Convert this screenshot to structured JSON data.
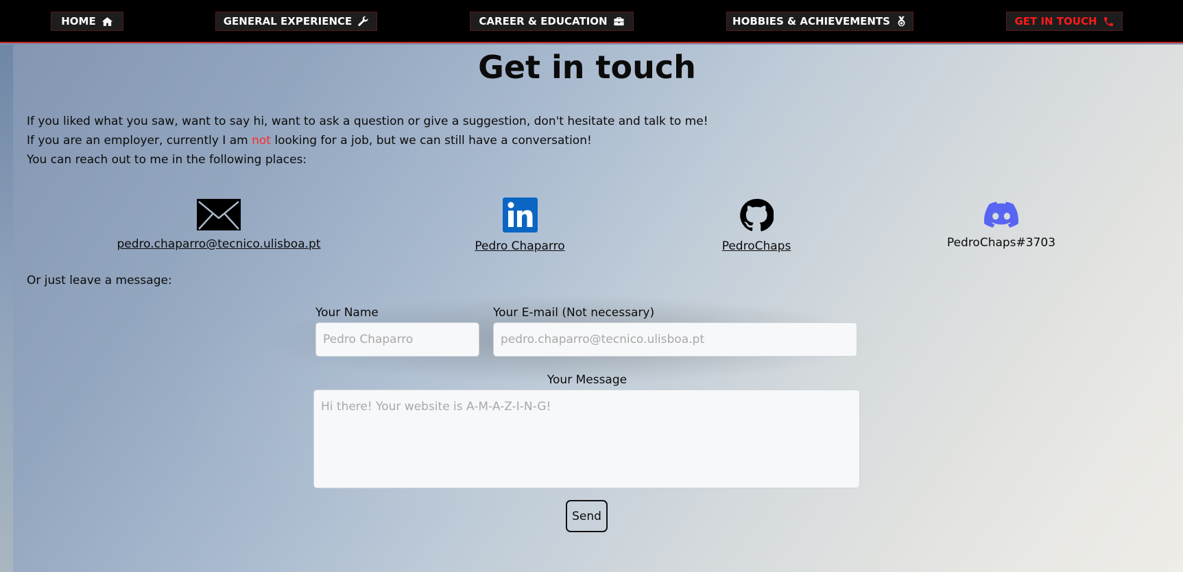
{
  "nav": {
    "items": [
      {
        "label": "HOME",
        "icon": "home-icon"
      },
      {
        "label": "GENERAL EXPERIENCE",
        "icon": "wrench-icon"
      },
      {
        "label": "CAREER & EDUCATION",
        "icon": "briefcase-icon"
      },
      {
        "label": "HOBBIES & ACHIEVEMENTS",
        "icon": "medal-icon"
      },
      {
        "label": "GET IN TOUCH",
        "icon": "phone-icon"
      }
    ],
    "active": "GET IN TOUCH",
    "active_color": "#ff1a1a",
    "accent_border": "#c62828"
  },
  "page": {
    "title": "Get in touch",
    "intro_line1": "If you liked what you saw, want to say hi, want to ask a question or give a suggestion, don't hesitate and talk to me!",
    "intro_line2_before": "If you are an employer, currently I am ",
    "intro_line2_emph": "not",
    "intro_line2_after": " looking for a job, but we can still have a conversation!",
    "intro_line3": "You can reach out to me in the following places:",
    "leave_message": "Or just leave a message:"
  },
  "contacts": {
    "email": {
      "label": "pedro.chaparro@tecnico.ulisboa.pt",
      "icon": "envelope-icon"
    },
    "linkedin": {
      "label": "Pedro Chaparro",
      "icon": "linkedin-icon",
      "color": "#0a66c2"
    },
    "github": {
      "label": "PedroChaps",
      "icon": "github-icon"
    },
    "discord": {
      "label": "PedroChaps#3703",
      "icon": "discord-icon",
      "color": "#5865f2"
    }
  },
  "form": {
    "name_label": "Your Name",
    "name_placeholder": "Pedro Chaparro",
    "email_label": "Your E-mail (Not necessary)",
    "email_placeholder": "pedro.chaparro@tecnico.ulisboa.pt",
    "message_label": "Your Message",
    "message_placeholder": "Hi there! Your website is A-M-A-Z-I-N-G!",
    "send_label": "Send"
  }
}
